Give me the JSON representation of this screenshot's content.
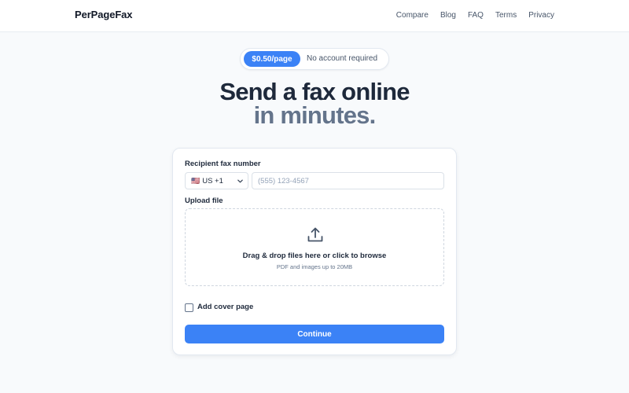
{
  "header": {
    "logo": "PerPageFax",
    "nav": [
      "Compare",
      "Blog",
      "FAQ",
      "Terms",
      "Privacy"
    ]
  },
  "pill": {
    "price": "$0.50/page",
    "text": "No account required"
  },
  "hero": {
    "line1": "Send a fax online",
    "line2": "in minutes."
  },
  "form": {
    "recipient_label": "Recipient fax number",
    "country_flag": "🇺🇸",
    "country_value": "US +1",
    "fax_placeholder": "(555) 123-4567",
    "upload_label": "Upload file",
    "dropzone_title": "Drag & drop files here or click to browse",
    "dropzone_hint": "PDF and images up to 20MB",
    "cover_label": "Add cover page",
    "cover_checked": false,
    "continue_label": "Continue"
  },
  "colors": {
    "accent": "#3b82f6",
    "heading": "#1e293b",
    "muted_heading": "#64748b"
  }
}
